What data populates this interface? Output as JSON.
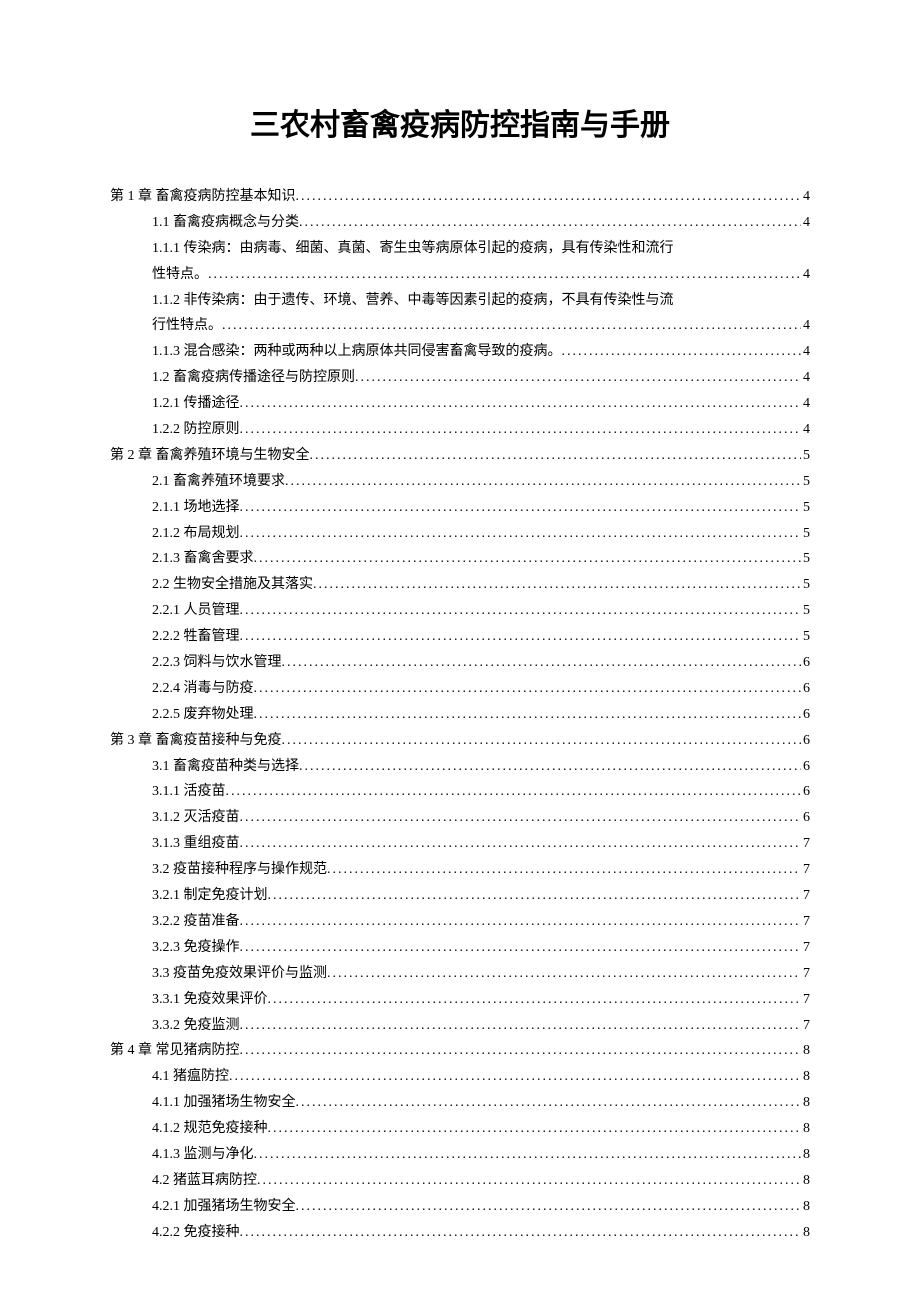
{
  "title": "三农村畜禽疫病防控指南与手册",
  "toc": [
    {
      "level": 0,
      "text": "第 1 章 畜禽疫病防控基本知识",
      "page": "4"
    },
    {
      "level": 1,
      "text": "1.1 畜禽疫病概念与分类",
      "page": "4"
    },
    {
      "level": 1,
      "multiline": true,
      "line1": "1.1.1 传染病：由病毒、细菌、真菌、寄生虫等病原体引起的疫病，具有传染性和流行",
      "line2": "性特点。",
      "page": "4"
    },
    {
      "level": 1,
      "multiline": true,
      "line1": "1.1.2 非传染病：由于遗传、环境、营养、中毒等因素引起的疫病，不具有传染性与流",
      "line2": "行性特点。",
      "page": "4"
    },
    {
      "level": 1,
      "text": "1.1.3 混合感染：两种或两种以上病原体共同侵害畜禽导致的疫病。",
      "page": "4"
    },
    {
      "level": 1,
      "text": "1.2 畜禽疫病传播途径与防控原则",
      "page": "4"
    },
    {
      "level": 1,
      "text": "1.2.1 传播途径",
      "page": "4"
    },
    {
      "level": 1,
      "text": "1.2.2 防控原则",
      "page": "4"
    },
    {
      "level": 0,
      "text": "第 2 章 畜禽养殖环境与生物安全",
      "page": "5"
    },
    {
      "level": 1,
      "text": "2.1 畜禽养殖环境要求",
      "page": "5"
    },
    {
      "level": 1,
      "text": "2.1.1 场地选择",
      "page": "5"
    },
    {
      "level": 1,
      "text": "2.1.2 布局规划",
      "page": "5"
    },
    {
      "level": 1,
      "text": "2.1.3 畜禽舍要求",
      "page": "5"
    },
    {
      "level": 1,
      "text": "2.2 生物安全措施及其落实",
      "page": "5"
    },
    {
      "level": 1,
      "text": "2.2.1 人员管理",
      "page": "5"
    },
    {
      "level": 1,
      "text": "2.2.2 牲畜管理",
      "page": "5"
    },
    {
      "level": 1,
      "text": "2.2.3 饲料与饮水管理",
      "page": "6"
    },
    {
      "level": 1,
      "text": "2.2.4 消毒与防疫",
      "page": "6"
    },
    {
      "level": 1,
      "text": "2.2.5 废弃物处理",
      "page": "6"
    },
    {
      "level": 0,
      "text": "第 3 章 畜禽疫苗接种与免疫",
      "page": "6"
    },
    {
      "level": 1,
      "text": "3.1 畜禽疫苗种类与选择",
      "page": "6"
    },
    {
      "level": 1,
      "text": "3.1.1 活疫苗",
      "page": "6"
    },
    {
      "level": 1,
      "text": "3.1.2 灭活疫苗",
      "page": "6"
    },
    {
      "level": 1,
      "text": "3.1.3 重组疫苗",
      "page": "7"
    },
    {
      "level": 1,
      "text": "3.2 疫苗接种程序与操作规范",
      "page": "7"
    },
    {
      "level": 1,
      "text": "3.2.1 制定免疫计划",
      "page": "7"
    },
    {
      "level": 1,
      "text": "3.2.2 疫苗准备",
      "page": "7"
    },
    {
      "level": 1,
      "text": "3.2.3 免疫操作",
      "page": "7"
    },
    {
      "level": 1,
      "text": "3.3 疫苗免疫效果评价与监测",
      "page": "7"
    },
    {
      "level": 1,
      "text": "3.3.1 免疫效果评价",
      "page": "7"
    },
    {
      "level": 1,
      "text": "3.3.2 免疫监测",
      "page": "7"
    },
    {
      "level": 0,
      "text": "第 4 章 常见猪病防控",
      "page": "8"
    },
    {
      "level": 1,
      "text": "4.1 猪瘟防控",
      "page": "8"
    },
    {
      "level": 1,
      "text": "4.1.1 加强猪场生物安全",
      "page": "8"
    },
    {
      "level": 1,
      "text": "4.1.2 规范免疫接种",
      "page": "8"
    },
    {
      "level": 1,
      "text": "4.1.3 监测与净化",
      "page": "8"
    },
    {
      "level": 1,
      "text": "4.2 猪蓝耳病防控",
      "page": "8"
    },
    {
      "level": 1,
      "text": "4.2.1 加强猪场生物安全",
      "page": "8"
    },
    {
      "level": 1,
      "text": "4.2.2 免疫接种",
      "page": "8"
    }
  ]
}
